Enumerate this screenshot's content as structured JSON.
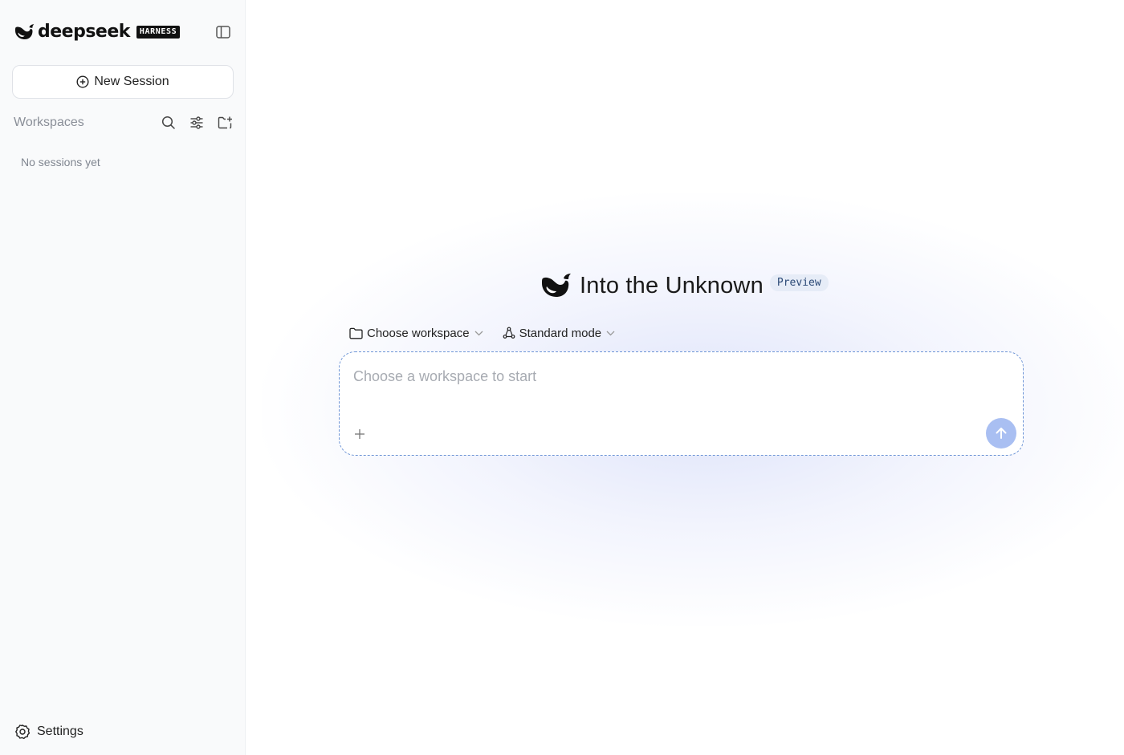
{
  "brand": {
    "name": "deepseek",
    "badge": "HARNESS"
  },
  "sidebar": {
    "new_session_label": "New Session",
    "workspaces_title": "Workspaces",
    "empty_text": "No sessions yet",
    "settings_label": "Settings",
    "tool_icons": [
      "search-icon",
      "sliders-icon",
      "folder-plus-icon"
    ]
  },
  "hero": {
    "title": "Into the Unknown",
    "badge": "Preview"
  },
  "selectors": {
    "workspace_label": "Choose workspace",
    "mode_label": "Standard mode"
  },
  "composer": {
    "placeholder": "Choose a workspace to start",
    "value": ""
  },
  "colors": {
    "accent": "#6e95d6",
    "send_button": "#a9bff2",
    "badge_bg": "#e6ecf7"
  }
}
